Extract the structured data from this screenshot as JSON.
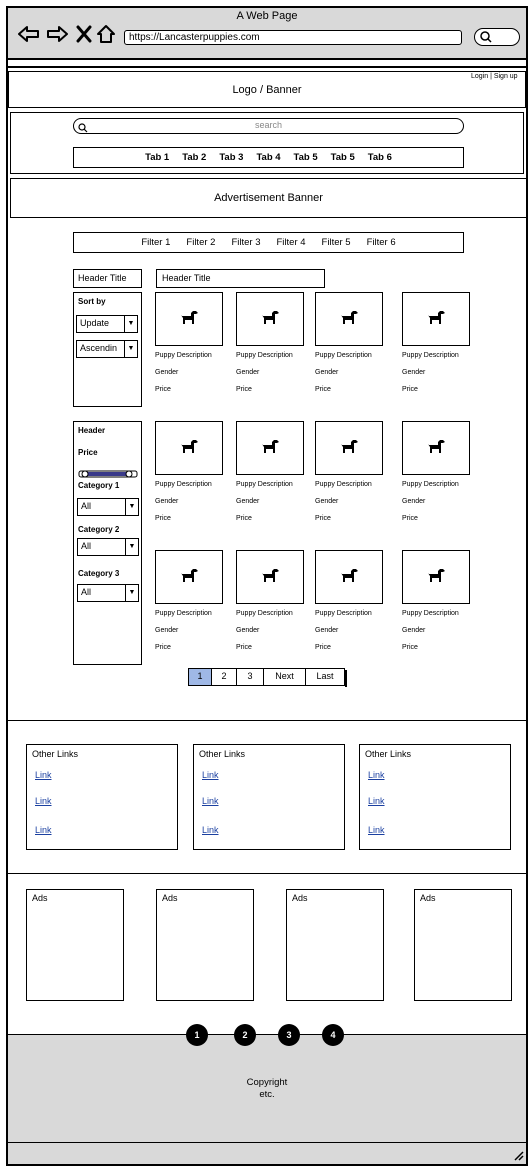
{
  "browser": {
    "window_title": "A Web Page",
    "url": "https://Lancasterpuppies.com",
    "icons": [
      "back-arrow-icon",
      "forward-arrow-icon",
      "close-x-icon",
      "home-icon",
      "search-icon"
    ]
  },
  "header": {
    "logo_banner": "Logo / Banner",
    "login_signup": "Login | Sign up"
  },
  "search": {
    "placeholder": "search"
  },
  "tabs": [
    "Tab 1",
    "Tab 2",
    "Tab 3",
    "Tab 4",
    "Tab 5",
    "Tab 5",
    "Tab 6"
  ],
  "ad_banner": "Advertisement Banner",
  "filters": [
    "Filter 1",
    "Filter 2",
    "Filter 3",
    "Filter 4",
    "Filter 5",
    "Filter 6"
  ],
  "sidebar": {
    "header_title": "Header Title",
    "sort_by_label": "Sort by",
    "sort_select": "Update",
    "order_select": "Ascendin",
    "filter_header": "Header",
    "price_label": "Price",
    "category1_label": "Category 1",
    "category1_value": "All",
    "category2_label": "Category 2",
    "category2_value": "All",
    "category3_label": "Category 3",
    "category3_value": "All"
  },
  "main": {
    "header_title": "Header Title",
    "card": {
      "description": "Puppy Description",
      "gender": "Gender",
      "price": "Price",
      "image_icon": "dog-icon"
    }
  },
  "pagination": [
    "1",
    "2",
    "3",
    "Next",
    "Last"
  ],
  "pagination_active": "1",
  "links_section": {
    "title": "Other Links",
    "link_text": "Link"
  },
  "ads": [
    "Ads",
    "Ads",
    "Ads",
    "Ads"
  ],
  "carousel_dots": [
    "1",
    "2",
    "3",
    "4"
  ],
  "footer": {
    "line1": "Copyright",
    "line2": "etc."
  },
  "colors": {
    "chrome_gray": "#d9d9d9",
    "active_page": "#9fb8e6",
    "link": "#1a3fa0",
    "slider": "#3a3a8a"
  }
}
